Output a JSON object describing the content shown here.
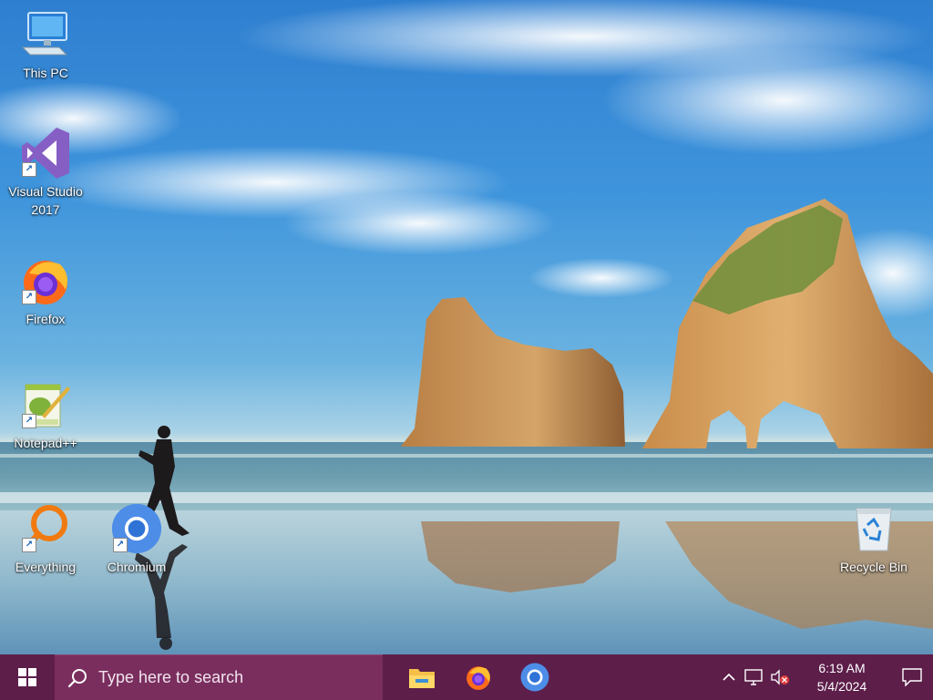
{
  "desktop_icons": [
    {
      "label": "This PC",
      "icon": "computer-icon",
      "shortcut": false
    },
    {
      "label": "Visual Studio 2017",
      "icon": "visual-studio-icon",
      "shortcut": true
    },
    {
      "label": "Firefox",
      "icon": "firefox-icon",
      "shortcut": true
    },
    {
      "label": "Notepad++",
      "icon": "notepad-plus-plus-icon",
      "shortcut": true
    },
    {
      "label": "Everything",
      "icon": "everything-search-icon",
      "shortcut": true
    },
    {
      "label": "Chromium",
      "icon": "chromium-icon",
      "shortcut": true
    },
    {
      "label": "Recycle Bin",
      "icon": "recycle-bin-icon",
      "shortcut": false
    }
  ],
  "taskbar": {
    "search_placeholder": "Type here to search",
    "pinned_apps": [
      "file-explorer-icon",
      "firefox-icon",
      "chromium-icon"
    ],
    "clock": {
      "time": "6:19 AM",
      "date": "5/4/2024"
    },
    "tray_icons": [
      "chevron-up-icon",
      "network-icon",
      "volume-muted-icon"
    ],
    "colors": {
      "taskbar": "#5d1e4a",
      "search": "#7a2e5e"
    }
  }
}
